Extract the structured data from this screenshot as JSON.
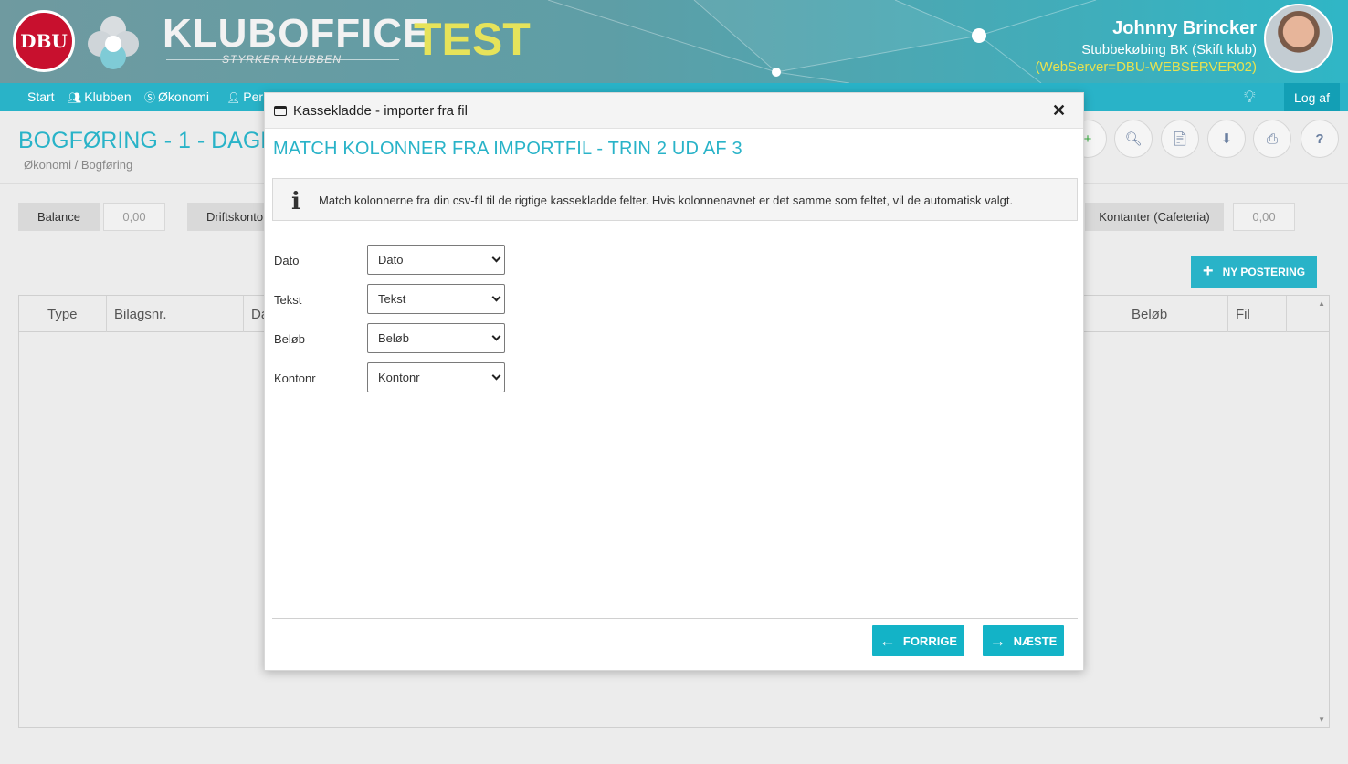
{
  "header": {
    "logo_text": "DBU",
    "brand": "KLUBOFFICE",
    "brand_sub": "STYRKER KLUBBEN",
    "brand_env": "TEST",
    "user_name": "Johnny Brincker",
    "user_club": "Stubbekøbing BK (Skift klub)",
    "web_server": "(WebServer=DBU-WEBSERVER02)"
  },
  "nav": {
    "items": [
      "Start",
      "Klubben",
      "Økonomi",
      "Per"
    ],
    "logout": "Log af"
  },
  "page": {
    "title": "BOGFØRING - 1 - DAGL",
    "breadcrumb": "Økonomi / Bogføring"
  },
  "summary": [
    {
      "label": "Balance",
      "value": "0,00"
    },
    {
      "label": "Driftskonto",
      "value": ""
    },
    {
      "label": "Kontanter (Cafeteria)",
      "value": "0,00"
    }
  ],
  "new_posting": "NY POSTERING",
  "grid_columns": [
    "Type",
    "Bilagsnr.",
    "Da",
    "Beløb",
    "Fil"
  ],
  "modal": {
    "window_title": "Kassekladde - importer fra fil",
    "step_title": "MATCH KOLONNER FRA IMPORTFIL - TRIN 2 UD AF 3",
    "info": "Match kolonnerne fra din csv-fil til de rigtige kassekladde felter. Hvis kolonnenavnet er det samme som feltet, vil de automatisk valgt.",
    "fields": [
      {
        "label": "Dato",
        "selected": "Dato"
      },
      {
        "label": "Tekst",
        "selected": "Tekst"
      },
      {
        "label": "Beløb",
        "selected": "Beløb"
      },
      {
        "label": "Kontonr",
        "selected": "Kontonr"
      }
    ],
    "prev_label": "FORRIGE",
    "next_label": "NÆSTE"
  },
  "colors": {
    "accent": "#29b3c8",
    "test": "#e6e35a"
  }
}
